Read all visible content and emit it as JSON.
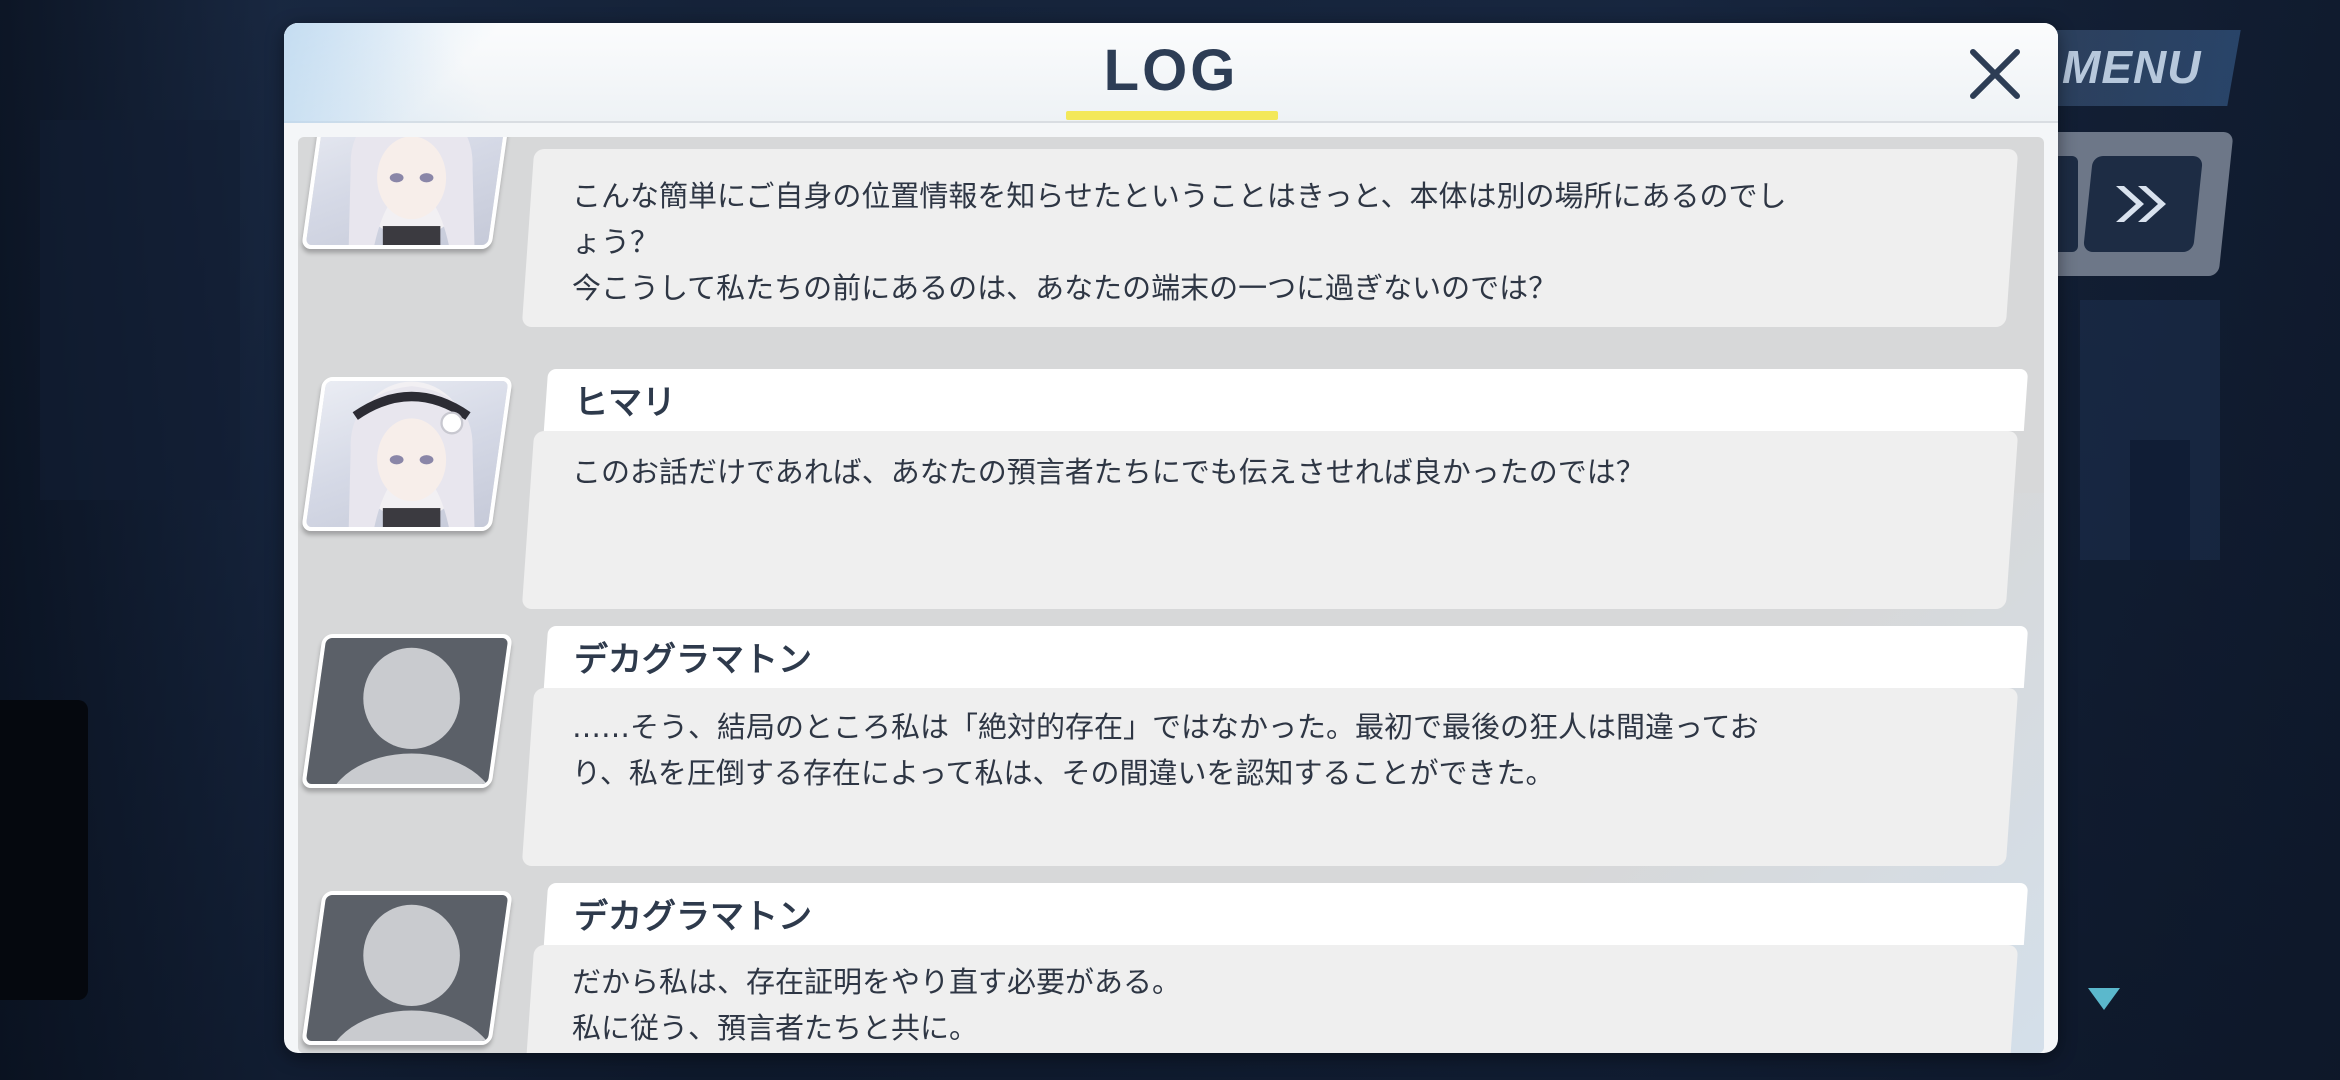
{
  "modal": {
    "title": "LOG"
  },
  "hud": {
    "menu_label": "MENU"
  },
  "entries": [
    {
      "speaker": "",
      "avatar": "himari",
      "text": "こんな簡単にご自身の位置情報を知らせたということはきっと、本体は別の場所にあるのでしょう？\n今こうして私たちの前にあるのは、あなたの端末の一つに過ぎないのでは？"
    },
    {
      "speaker": "ヒマリ",
      "avatar": "himari",
      "text": "このお話だけであれば、あなたの預言者たちにでも伝えさせれば良かったのでは？"
    },
    {
      "speaker": "デカグラマトン",
      "avatar": "unknown",
      "text": "……そう、結局のところ私は「絶対的存在」ではなかった。最初で最後の狂人は間違っており、私を圧倒する存在によって私は、その間違いを認知することができた。"
    },
    {
      "speaker": "デカグラマトン",
      "avatar": "unknown",
      "text": "だから私は、存在証明をやり直す必要がある。\n私に従う、預言者たちと共に。"
    }
  ],
  "colors": {
    "title": "#2d3d55",
    "title_underline": "#f3e85a",
    "name_bar": "#ffffff",
    "text_box": "#efefef",
    "log_area": "#d7d8d9"
  },
  "icons": {
    "close": "close-icon",
    "skip": "fast-forward-icon",
    "scroll": "triangle-down-icon"
  }
}
